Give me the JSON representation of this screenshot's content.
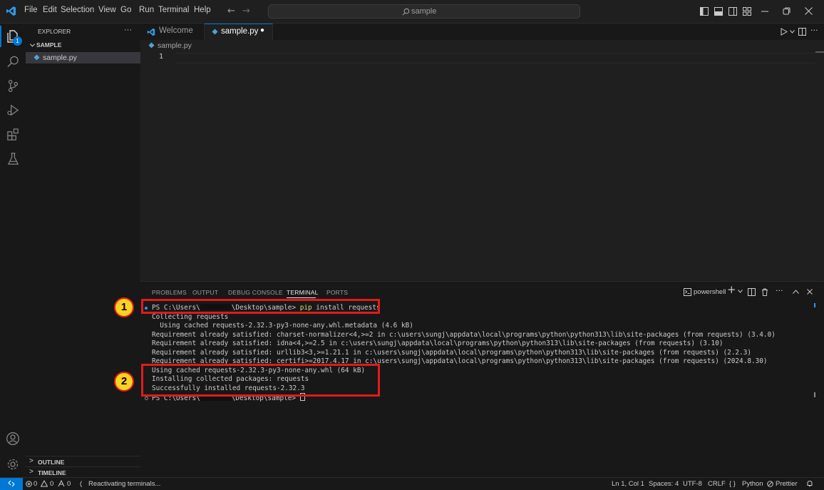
{
  "menu": [
    "File",
    "Edit",
    "Selection",
    "View",
    "Go",
    "Run",
    "Terminal",
    "Help"
  ],
  "search": {
    "text": "sample"
  },
  "explorer": {
    "title": "EXPLORER",
    "more": "···",
    "folder": "SAMPLE",
    "file": "sample.py"
  },
  "sidebar_sections": {
    "outline": "OUTLINE",
    "timeline": "TIMELINE"
  },
  "badge": "1",
  "tabs": [
    {
      "label": "Welcome"
    },
    {
      "label": "sample.py",
      "modified": "●"
    }
  ],
  "breadcrumb": "sample.py",
  "editor": {
    "line": "1"
  },
  "panel": {
    "tabs": [
      "PROBLEMS",
      "OUTPUT",
      "DEBUG CONSOLE",
      "TERMINAL",
      "PORTS"
    ],
    "shell": "powershell"
  },
  "terminal": {
    "prompt1_a": "PS C:\\Users\\",
    "prompt1_b": "\\Desktop\\sample>",
    "cmd": "pip",
    "cmd_rest": "install requests",
    "lines": [
      "Collecting requests",
      "  Using cached requests-2.32.3-py3-none-any.whl.metadata (4.6 kB)",
      "Requirement already satisfied: charset-normalizer<4,>=2 in c:\\users\\sungj\\appdata\\local\\programs\\python\\python313\\lib\\site-packages (from requests) (3.4.0)",
      "Requirement already satisfied: idna<4,>=2.5 in c:\\users\\sungj\\appdata\\local\\programs\\python\\python313\\lib\\site-packages (from requests) (3.10)",
      "Requirement already satisfied: urllib3<3,>=1.21.1 in c:\\users\\sungj\\appdata\\local\\programs\\python\\python313\\lib\\site-packages (from requests) (2.2.3)",
      "Requirement already satisfied: certifi>=2017.4.17 in c:\\users\\sungj\\appdata\\local\\programs\\python\\python313\\lib\\site-packages (from requests) (2024.8.30)",
      "Using cached requests-2.32.3-py3-none-any.whl (64 kB)",
      "Installing collected packages: requests",
      "Successfully installed requests-2.32.3"
    ],
    "prompt2_a": "PS C:\\Users\\",
    "prompt2_b": "\\Desktop\\sample>"
  },
  "markers": [
    "1",
    "2"
  ],
  "status": {
    "errors": "0",
    "warnings": "0",
    "ports": "0",
    "activity": "Reactivating terminals...",
    "position": "Ln 1, Col 1",
    "spaces": "Spaces: 4",
    "encoding": "UTF-8",
    "eol": "CRLF",
    "language": "Python",
    "prettier": "Prettier"
  },
  "colors": {
    "accent": "#0078d4",
    "highlight": "#e11b1b",
    "marker": "#ffd21f",
    "python": "#4fa3d1"
  }
}
